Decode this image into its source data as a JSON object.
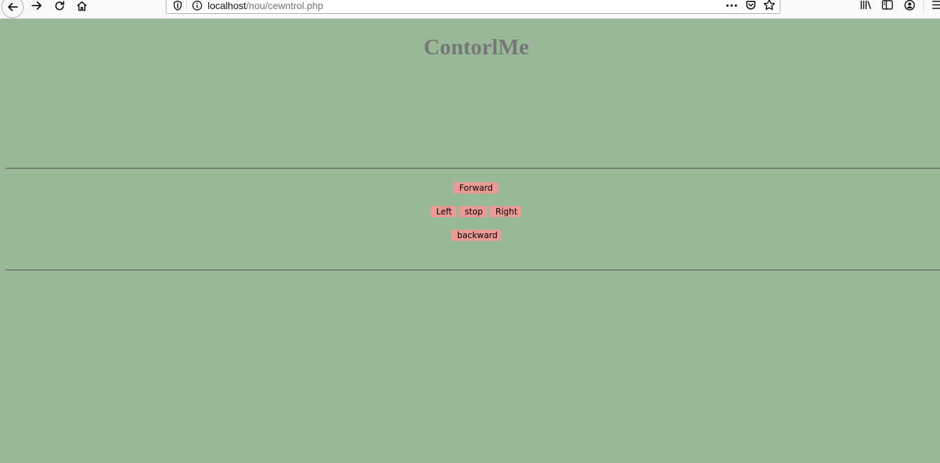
{
  "browser": {
    "url_host": "localhost",
    "url_path": "/nou/cewntrol.php"
  },
  "page": {
    "title": "ContorlMe",
    "background_color": "#99b898",
    "button_color": "#ec9a94",
    "buttons": {
      "forward": "Forward",
      "left": "Left",
      "stop": "stop",
      "right": "Right",
      "backward": "backward"
    }
  }
}
